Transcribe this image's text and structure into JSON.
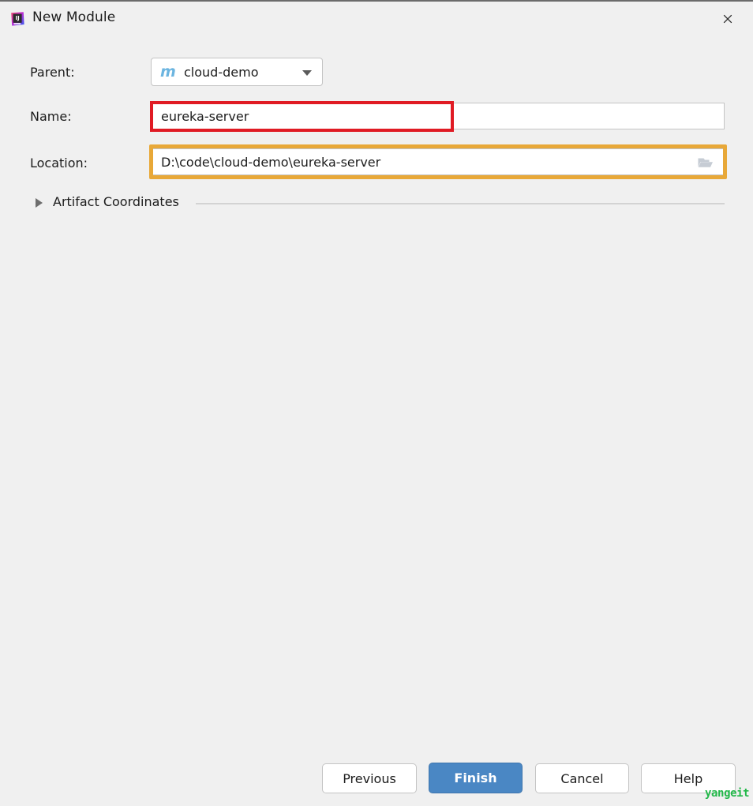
{
  "window": {
    "title": "New Module",
    "app_icon": "intellij-idea-icon",
    "close_icon": "close-icon",
    "background_color": "#f0f0f0"
  },
  "form": {
    "parent": {
      "label": "Parent:",
      "icon": "maven-module-icon",
      "icon_glyph": "m",
      "icon_color": "#6cb5e0",
      "value": "cloud-demo",
      "arrow_icon": "chevron-down-icon"
    },
    "name": {
      "label": "Name:",
      "value": "eureka-server",
      "placeholder": ""
    },
    "location": {
      "label": "Location:",
      "value": "D:\\code\\cloud-demo\\eureka-server",
      "placeholder": "",
      "browse_icon": "folder-open-icon"
    }
  },
  "artifact_section": {
    "label": "Artifact Coordinates",
    "expanded": false,
    "disclosure_icon": "triangle-right-icon"
  },
  "annotations": {
    "name_highlight_color": "#e01b24",
    "location_highlight_color": "#e8a838"
  },
  "buttons": {
    "previous": "Previous",
    "finish": "Finish",
    "cancel": "Cancel",
    "help": "Help",
    "finish_color": "#4a87c4"
  },
  "watermark": {
    "text": "yangeit",
    "color": "#23b84a"
  }
}
